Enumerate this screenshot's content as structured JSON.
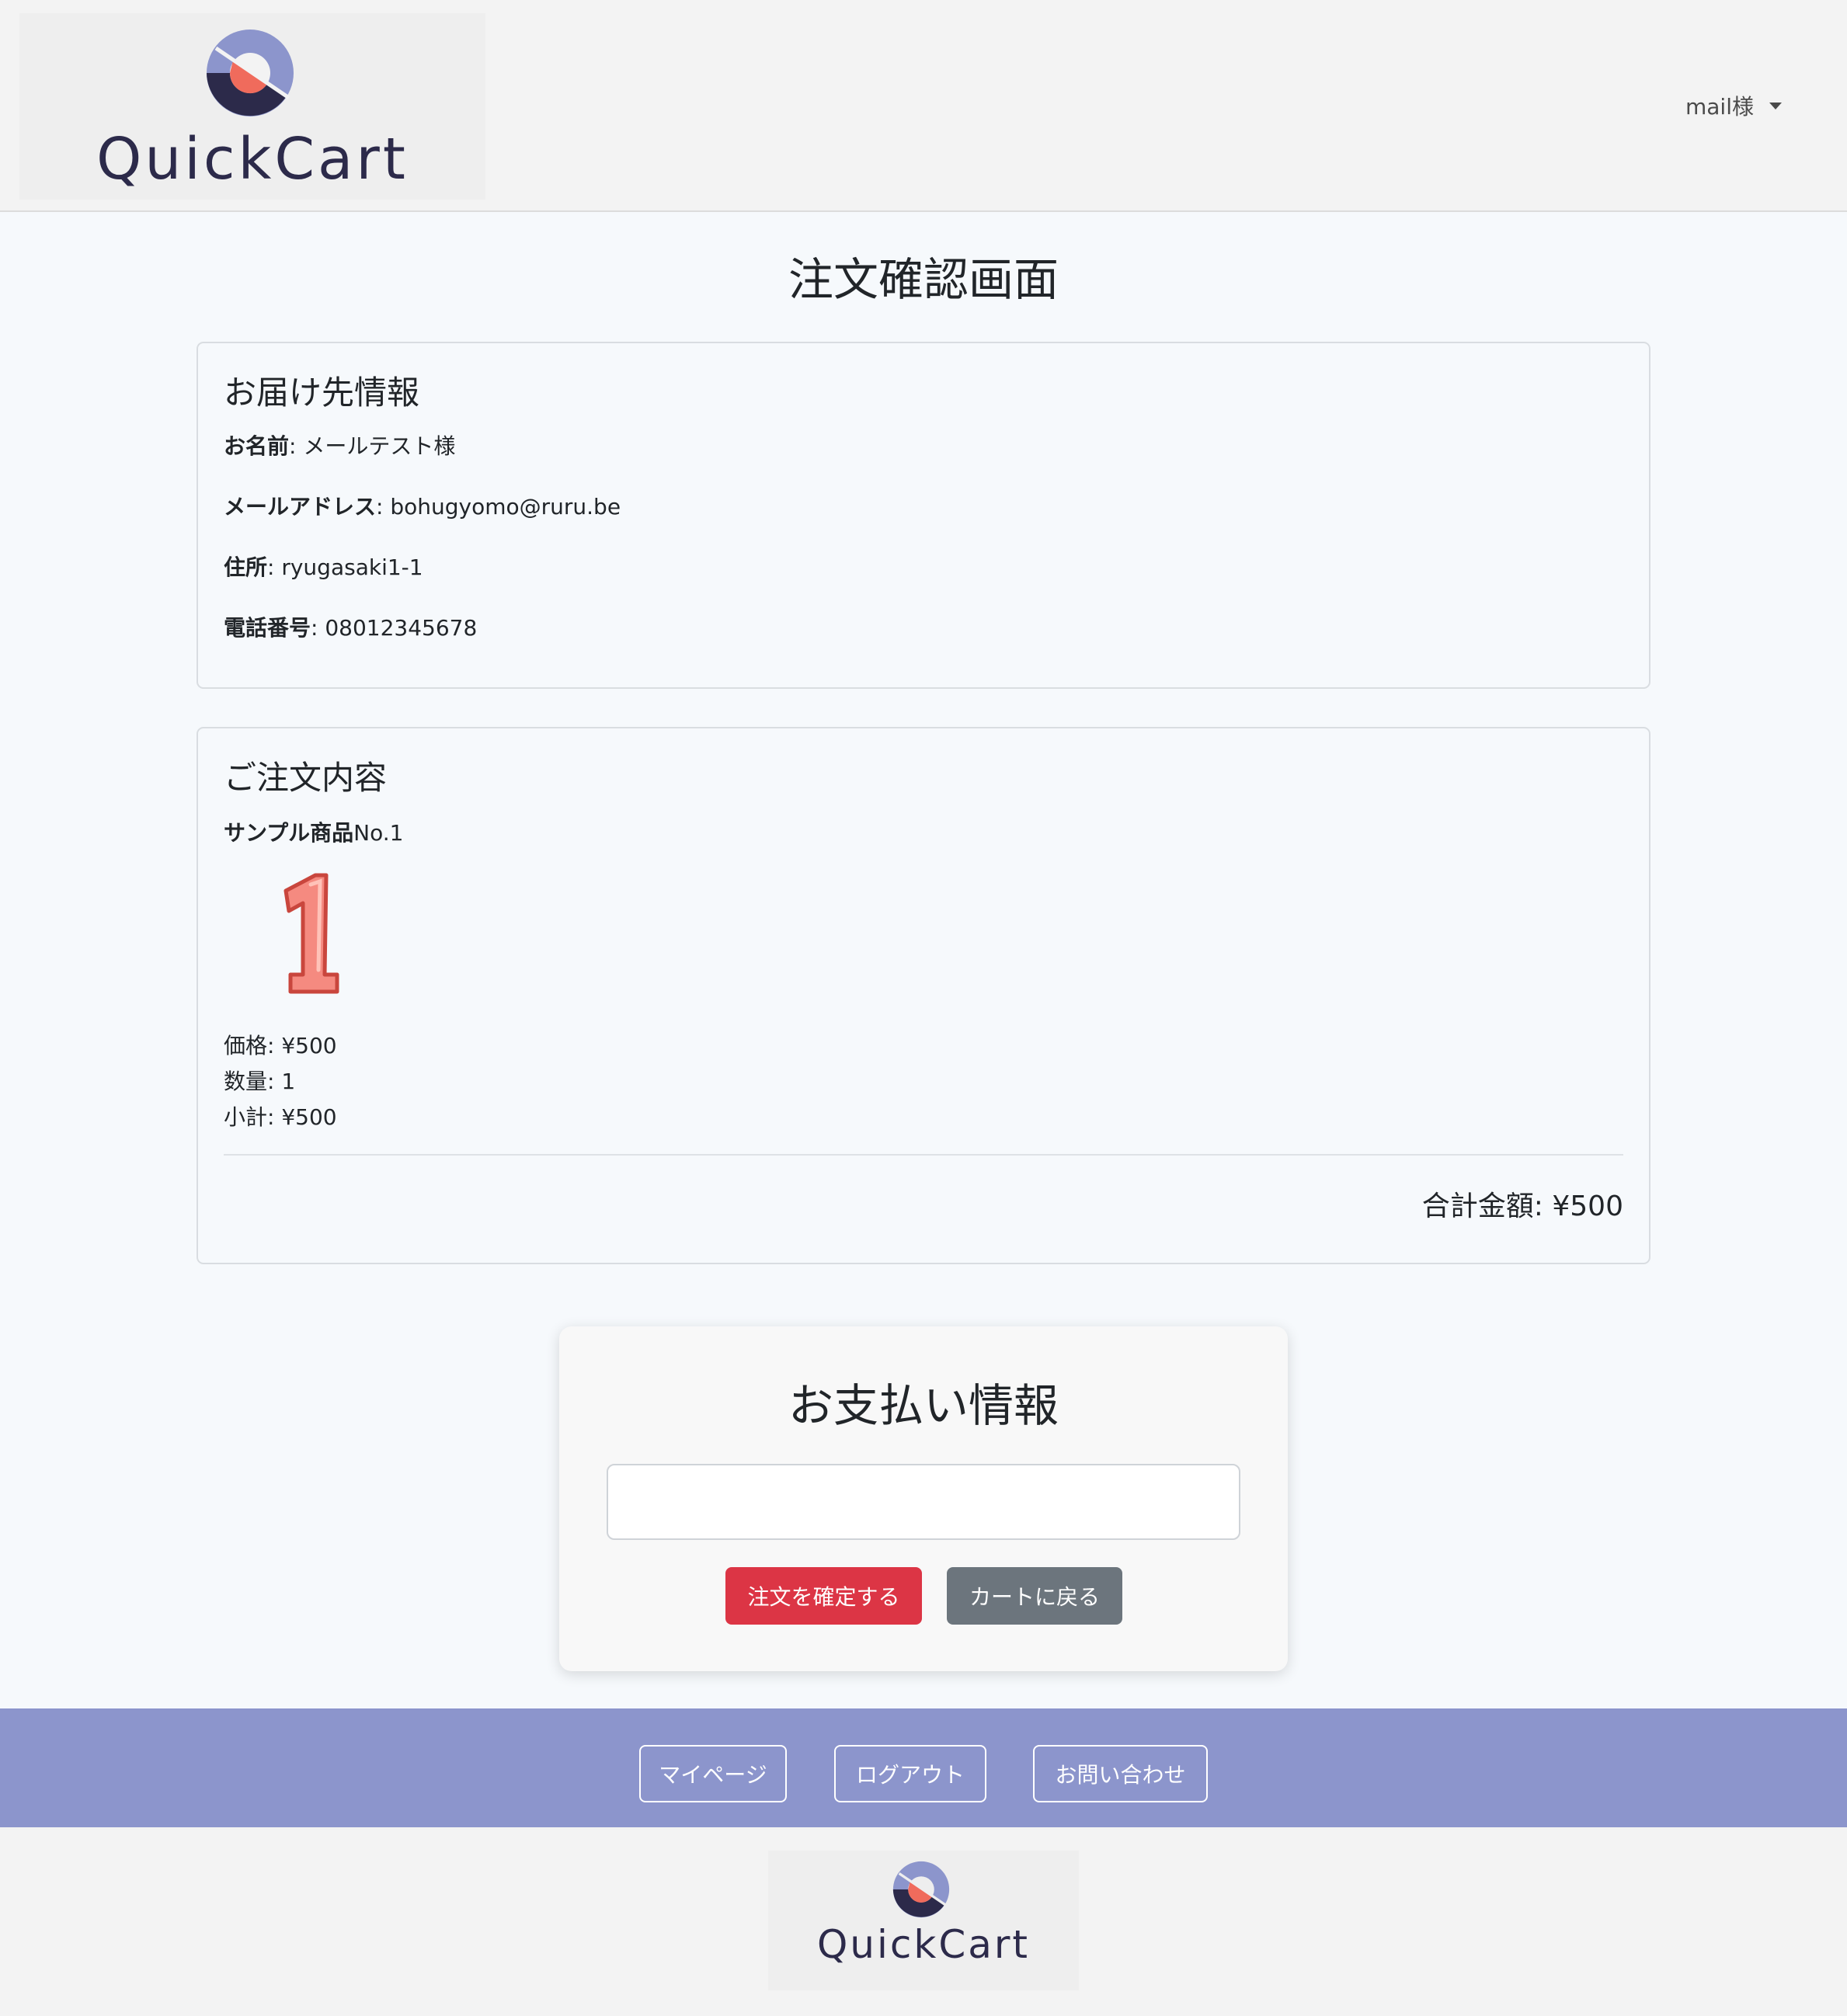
{
  "header": {
    "logo_text": "QuickCart",
    "user_menu_label": "mail様"
  },
  "page": {
    "title": "注文確認画面"
  },
  "shipping": {
    "title": "お届け先情報",
    "name_label": "お名前",
    "name_value": ": メールテスト様",
    "email_label": "メールアドレス",
    "email_value": ": bohugyomo@ruru.be",
    "address_label": "住所",
    "address_value": ": ryugasaki1-1",
    "phone_label": "電話番号",
    "phone_value": ": 08012345678"
  },
  "order": {
    "title": "ご注文内容",
    "items": [
      {
        "name_bold": "サンプル商品",
        "name_rest": "No.1",
        "image_glyph": "1",
        "price": "価格: ¥500",
        "quantity": "数量: 1",
        "subtotal": "小計: ¥500"
      }
    ],
    "total": "合計金額: ¥500"
  },
  "payment": {
    "title": "お支払い情報",
    "card_input_placeholder": "",
    "confirm_label": "注文を確定する",
    "back_label": "カートに戻る"
  },
  "footer": {
    "links": [
      "マイページ",
      "ログアウト",
      "お問い合わせ"
    ],
    "logo_text": "QuickCart"
  },
  "colors": {
    "accent_red": "#dc3545",
    "secondary_gray": "#6c757d",
    "footer_purple": "#8c95cc",
    "logo_dark": "#2c2a4a",
    "logo_light": "#8c95cc",
    "logo_coral": "#f06b5c"
  },
  "icons": {
    "logo": "quickcart-logo-icon",
    "user_caret": "caret-down-icon"
  }
}
